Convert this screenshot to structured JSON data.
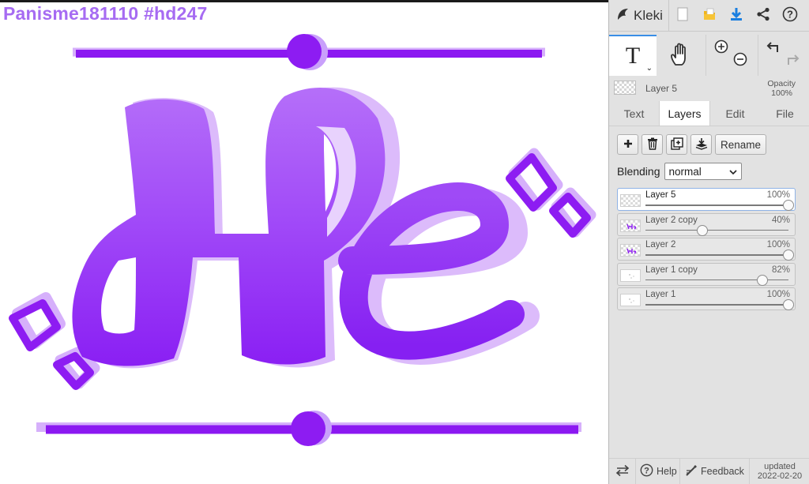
{
  "canvas": {
    "title": "Panisme181110 #hd247",
    "title_color": "#a66bf2",
    "art_primary_color": "#9b30f7",
    "art_shadow_color": "#d3a8f9"
  },
  "app": {
    "name": "Kleki",
    "icons": [
      "kleki-logo-icon",
      "new-image-icon",
      "open-folder-icon",
      "download-icon",
      "share-icon",
      "help-circle-icon"
    ]
  },
  "tools": {
    "text_glyph": "T",
    "text_chevron": "⌄",
    "icons": [
      "text-tool-icon",
      "hand-tool-icon",
      "zoom-in-icon",
      "zoom-out-icon",
      "undo-icon",
      "redo-icon"
    ]
  },
  "layer_status": {
    "name": "Layer 5",
    "opacity_label": "Opacity",
    "opacity_value": "100%"
  },
  "tabs": [
    "Text",
    "Layers",
    "Edit",
    "File"
  ],
  "active_tab": "Layers",
  "layers_panel": {
    "action_icons": [
      "add-layer-icon",
      "delete-layer-icon",
      "duplicate-layer-icon",
      "merge-down-icon"
    ],
    "rename_label": "Rename",
    "blending_label": "Blending",
    "blending_value": "normal"
  },
  "layers": [
    {
      "name": "Layer 5",
      "opacity": "100%",
      "level": 1.0,
      "selected": true,
      "thumb": "transparent"
    },
    {
      "name": "Layer 2 copy",
      "opacity": "40%",
      "level": 0.4,
      "selected": false,
      "thumb": "purple-art"
    },
    {
      "name": "Layer 2",
      "opacity": "100%",
      "level": 1.0,
      "selected": false,
      "thumb": "purple-art"
    },
    {
      "name": "Layer 1 copy",
      "opacity": "82%",
      "level": 0.82,
      "selected": false,
      "thumb": "white-specks"
    },
    {
      "name": "Layer 1",
      "opacity": "100%",
      "level": 1.0,
      "selected": false,
      "thumb": "white-specks"
    }
  ],
  "footer": {
    "help_label": "Help",
    "feedback_label": "Feedback",
    "updated_label": "updated",
    "updated_date": "2022-02-20",
    "icons": [
      "swap-icon",
      "help-icon",
      "feedback-icon"
    ]
  }
}
